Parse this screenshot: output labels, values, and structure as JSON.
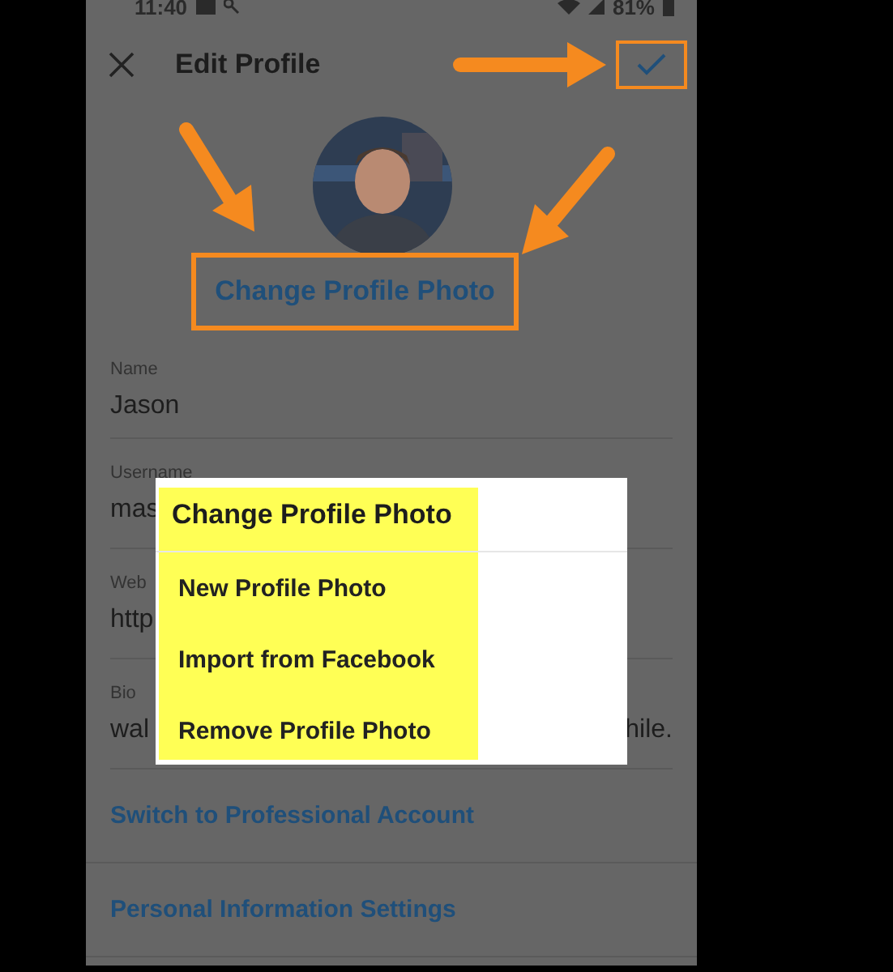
{
  "status_bar": {
    "time": "11:40",
    "battery": "81%"
  },
  "header": {
    "title": "Edit Profile"
  },
  "change_photo_link": "Change Profile Photo",
  "fields": [
    {
      "label": "Name",
      "value": "Jason"
    },
    {
      "label": "Username",
      "value": "mas"
    },
    {
      "label": "Web",
      "value": "http"
    },
    {
      "label": "Bio",
      "value": "wal",
      "value_end": "hile."
    }
  ],
  "links": [
    "Switch to Professional Account",
    "Personal Information Settings"
  ],
  "dialog": {
    "title": "Change Profile Photo",
    "items": [
      "New Profile Photo",
      "Import from Facebook",
      "Remove Profile Photo"
    ]
  }
}
